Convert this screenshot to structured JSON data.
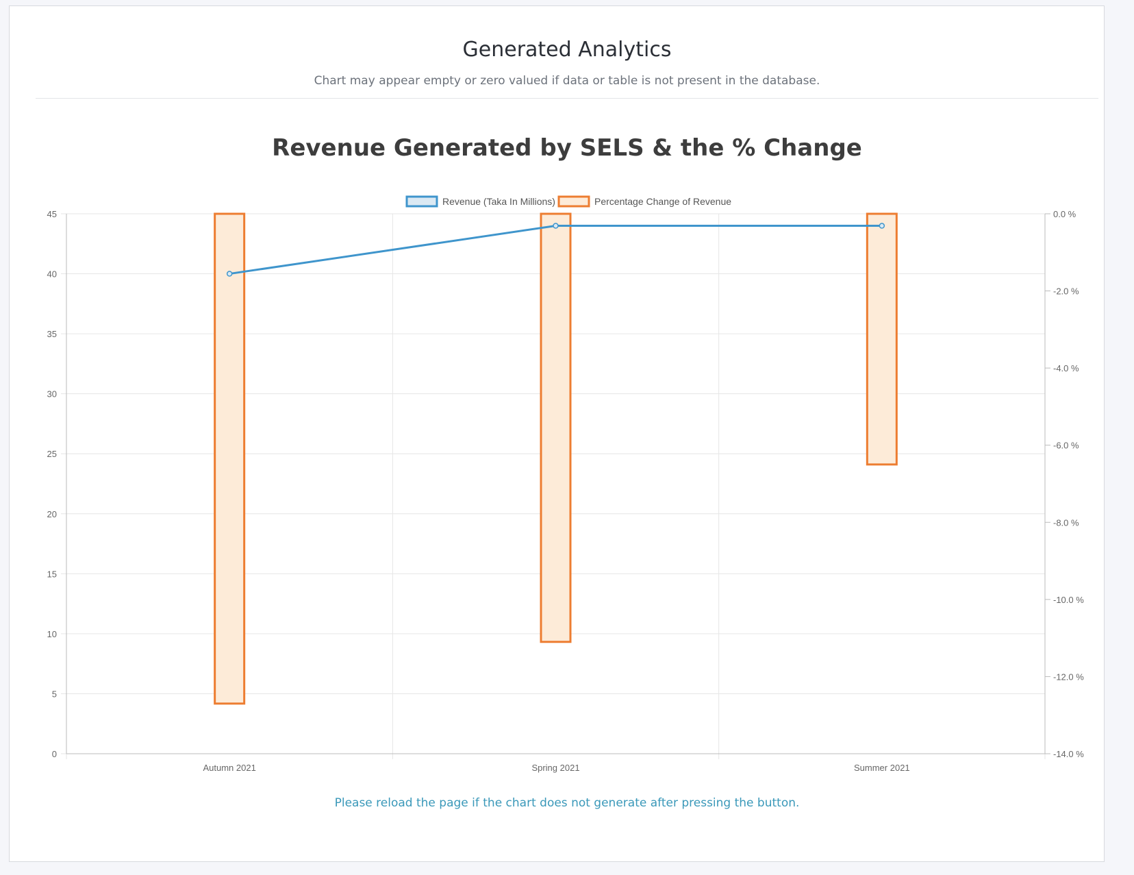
{
  "page": {
    "heading": "Generated Analytics",
    "subheading": "Chart may appear empty or zero valued if data or table is not present in the database.",
    "reload_note": "Please reload the page if the chart does not generate after pressing the button."
  },
  "colors": {
    "revenue_line": "#3f95cc",
    "revenue_fill": "#dbe9f3",
    "change_border": "#ed7d31",
    "change_fill": "#fdebd8",
    "grid": "#e6e6e6",
    "axis": "#bbbbbb"
  },
  "chart_data": {
    "type": "bar",
    "title": "Revenue Generated by SELS & the % Change",
    "categories": [
      "Autumn 2021",
      "Spring 2021",
      "Summer 2021"
    ],
    "legend": "top-center",
    "grid": true,
    "series": [
      {
        "name": "Revenue (Taka In Millions)",
        "type": "line",
        "axis": "left",
        "values": [
          40,
          44,
          44
        ]
      },
      {
        "name": "Percentage Change of Revenue",
        "type": "bar",
        "axis": "right",
        "values": [
          -12.7,
          -11.1,
          -6.5
        ]
      }
    ],
    "y_left": {
      "ylim": [
        0,
        45
      ],
      "ticks": [
        "0",
        "5",
        "10",
        "15",
        "20",
        "25",
        "30",
        "35",
        "40",
        "45"
      ]
    },
    "y_right": {
      "ylim": [
        -14,
        0
      ],
      "ticks": [
        "0.0 %",
        "-2.0 %",
        "-4.0 %",
        "-6.0 %",
        "-8.0 %",
        "-10.0 %",
        "-12.0 %",
        "-14.0 %"
      ]
    }
  }
}
